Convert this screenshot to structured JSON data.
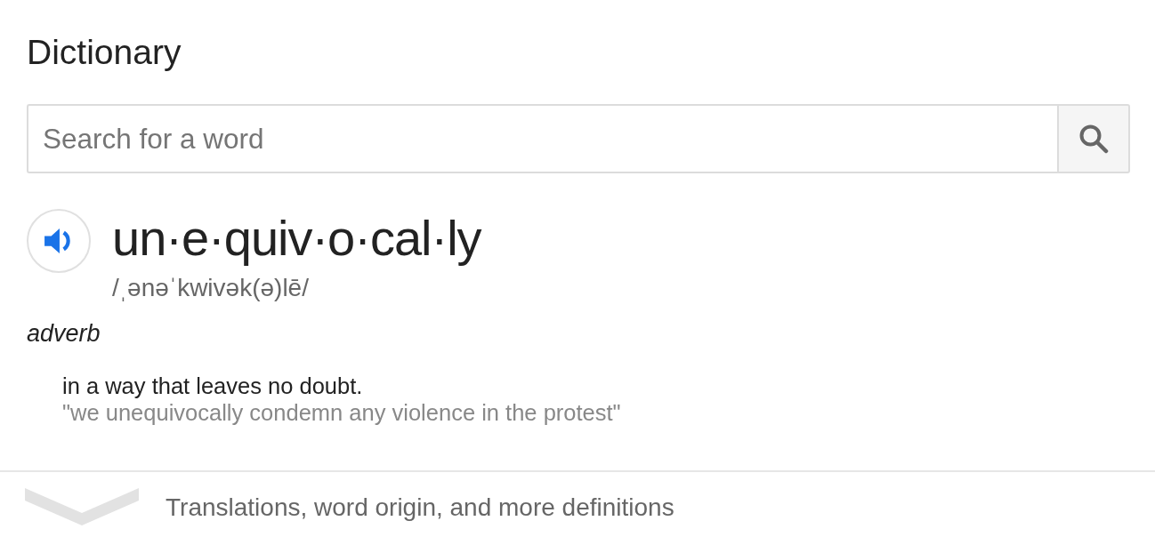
{
  "header": {
    "title": "Dictionary"
  },
  "search": {
    "placeholder": "Search for a word"
  },
  "entry": {
    "headword": "un·e·quiv·o·cal·ly",
    "phonetic": "/ˌənəˈkwivək(ə)lē/",
    "senses": [
      {
        "part_of_speech": "adverb",
        "definitions": [
          {
            "text": "in a way that leaves no doubt.",
            "example": "\"we unequivocally condemn any violence in the protest\""
          }
        ]
      }
    ]
  },
  "footer": {
    "label": "Translations, word origin, and more definitions",
    "expanded": false
  }
}
